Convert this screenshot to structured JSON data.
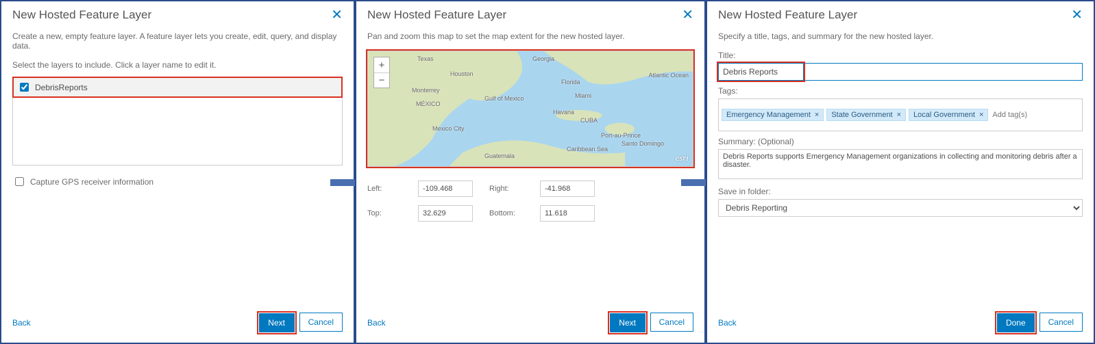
{
  "common": {
    "dialog_title": "New Hosted Feature Layer",
    "close": "✕",
    "back": "Back",
    "next": "Next",
    "cancel": "Cancel",
    "done": "Done"
  },
  "panel1": {
    "intro": "Create a new, empty feature layer. A feature layer lets you create, edit, query, and display data.",
    "select_hint": "Select the layers to include. Click a layer name to edit it.",
    "layers": [
      {
        "name": "DebrisReports",
        "checked": true
      }
    ],
    "gps_label": "Capture GPS receiver information",
    "gps_checked": false
  },
  "panel2": {
    "intro": "Pan and zoom this map to set the map extent for the new hosted layer.",
    "esri": "esri",
    "labels": {
      "left": "Left:",
      "right": "Right:",
      "top": "Top:",
      "bottom": "Bottom:"
    },
    "extent": {
      "left": "-109.468",
      "right": "-41.968",
      "top": "32.629",
      "bottom": "11.618"
    },
    "map_labels": [
      "Texas",
      "Houston",
      "Florida",
      "Miami",
      "Havana",
      "CUBA",
      "MÉXICO",
      "Monterrey",
      "Mexico City",
      "Guatemala",
      "Caribbean Sea",
      "Gulf of Mexico",
      "Port-au-Prince",
      "Santo Domingo",
      "Georgia",
      "Atlantic Ocean"
    ]
  },
  "panel3": {
    "intro": "Specify a title, tags, and summary for the new hosted layer.",
    "title_label": "Title:",
    "title_value": "Debris Reports",
    "tags_label": "Tags:",
    "tags": [
      "Emergency Management",
      "State Government",
      "Local Government"
    ],
    "tag_placeholder": "Add tag(s)",
    "summary_label": "Summary: (Optional)",
    "summary_value": "Debris Reports supports Emergency Management organizations in collecting and monitoring debris after a disaster.",
    "folder_label": "Save in folder:",
    "folder_value": "Debris Reporting"
  }
}
